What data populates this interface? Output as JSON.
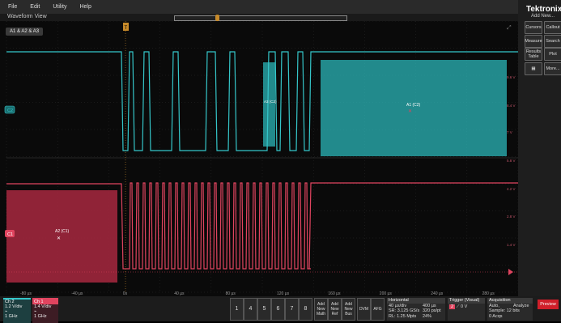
{
  "menu": {
    "items": [
      "File",
      "Edit",
      "Utility",
      "Help"
    ]
  },
  "window": {
    "title": "Waveform View"
  },
  "plot": {
    "legend": "A1 & A2 & A3",
    "trigger_marker": "T",
    "ch2_marker": "C2",
    "ch1_marker": "C1",
    "x_axis": {
      "ticks": [
        "-80 µs",
        "-40 µs",
        "0s",
        "40 µs",
        "80 µs",
        "120 µs",
        "160 µs",
        "200 µs",
        "240 µs",
        "280 µs"
      ],
      "range": [
        -80,
        280
      ],
      "unit": "µs"
    },
    "ch2_scale": [
      "9.6 V",
      "8.4 V",
      "7 V",
      "5.8 V"
    ],
    "ch1_scale": [
      "4.2 V",
      "2.8 V",
      "1.4 V"
    ],
    "areas": [
      {
        "label": "A2 (C1)"
      },
      {
        "label": "A3 (C2)"
      },
      {
        "label": "A1 (C2)"
      }
    ],
    "colors": {
      "ch1": "#e0445f",
      "ch2": "#35c6c9",
      "area2": "#2bb6b8",
      "area_red": "#a8283f",
      "trigger": "#c78a2a"
    }
  },
  "right_panel": {
    "brand": "Tektronix",
    "add_new": "Add New...",
    "buttons": [
      [
        "Cursors",
        "Callout"
      ],
      [
        "Measure",
        "Search"
      ],
      [
        "Results Table",
        "Plot"
      ],
      [
        "DVM-icon",
        "More..."
      ]
    ]
  },
  "channels": [
    {
      "name": "Ch 2",
      "vdiv": "1.2 V/div",
      "bw": "1 GHz"
    },
    {
      "name": "Ch 1",
      "vdiv": "1.4 V/div",
      "bw": "1 GHz"
    }
  ],
  "channel_buttons": [
    "1",
    "4",
    "5",
    "6",
    "7",
    "8"
  ],
  "add_buttons": [
    "Add New Math",
    "Add New Ref",
    "Add New Bus"
  ],
  "other_buttons": [
    "DVM",
    "AFG"
  ],
  "horizontal": {
    "title": "Horizontal",
    "row1": [
      "40 µs/div",
      "400 µs"
    ],
    "row2": [
      "SR: 3.125 GS/s",
      "320 ps/pt"
    ],
    "row3": [
      "RL: 1.25 Mpts",
      "24%"
    ]
  },
  "trigger": {
    "title": "Trigger (Visual)",
    "source": "2",
    "level": "0 V"
  },
  "acquisition": {
    "title": "Acquisition",
    "row1": [
      "Auto,",
      "Analyze"
    ],
    "row2": "Sample: 12 bits",
    "row3": "0 Acqs"
  },
  "preview_label": "Preview"
}
